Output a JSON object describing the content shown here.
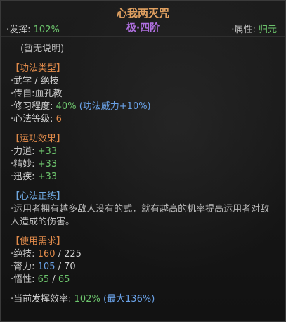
{
  "header": {
    "title": "心我两灭咒",
    "rank": "极·四阶",
    "left_label": "·发挥:",
    "left_value": "102%",
    "right_label": "·属性:",
    "right_value": "归元"
  },
  "description": "(暂无说明)",
  "type_section": {
    "heading": "【功法类型】",
    "category": "·武学 / 绝技",
    "origin_label": "·传自:",
    "origin_value": "血孔教",
    "practice_label": "·修习程度:",
    "practice_value": "40%",
    "practice_bonus": "(功法威力+10%)",
    "level_label": "·心法等级:",
    "level_value": "6"
  },
  "effects_section": {
    "heading": "【运功效果】",
    "items": [
      {
        "label": "·力道:",
        "value": "+33"
      },
      {
        "label": "·精妙:",
        "value": "+33"
      },
      {
        "label": "·迅疾:",
        "value": "+33"
      }
    ]
  },
  "method_section": {
    "heading": "【心法正练】",
    "text": "·运用者拥有越多敌人没有的式，就有越高的机率提高运用者对敌人造成的伤害。"
  },
  "requirements_section": {
    "heading": "【使用需求】",
    "items": [
      {
        "label": "·绝技:",
        "current": "160",
        "sep": " / ",
        "required": "225"
      },
      {
        "label": "·膂力:",
        "current": "105",
        "sep": " / ",
        "required": "70"
      },
      {
        "label": "·悟性:",
        "current": "65",
        "sep": " / ",
        "required": "65"
      }
    ]
  },
  "efficiency": {
    "label": "·当前发挥效率:",
    "value": "102%",
    "max": "(最大136%)"
  },
  "colors": {
    "title": "#e0a060",
    "rank": "#b070e0",
    "positive": "#6cc36c",
    "info": "#6aa2e8",
    "highlight": "#e08a4a"
  }
}
